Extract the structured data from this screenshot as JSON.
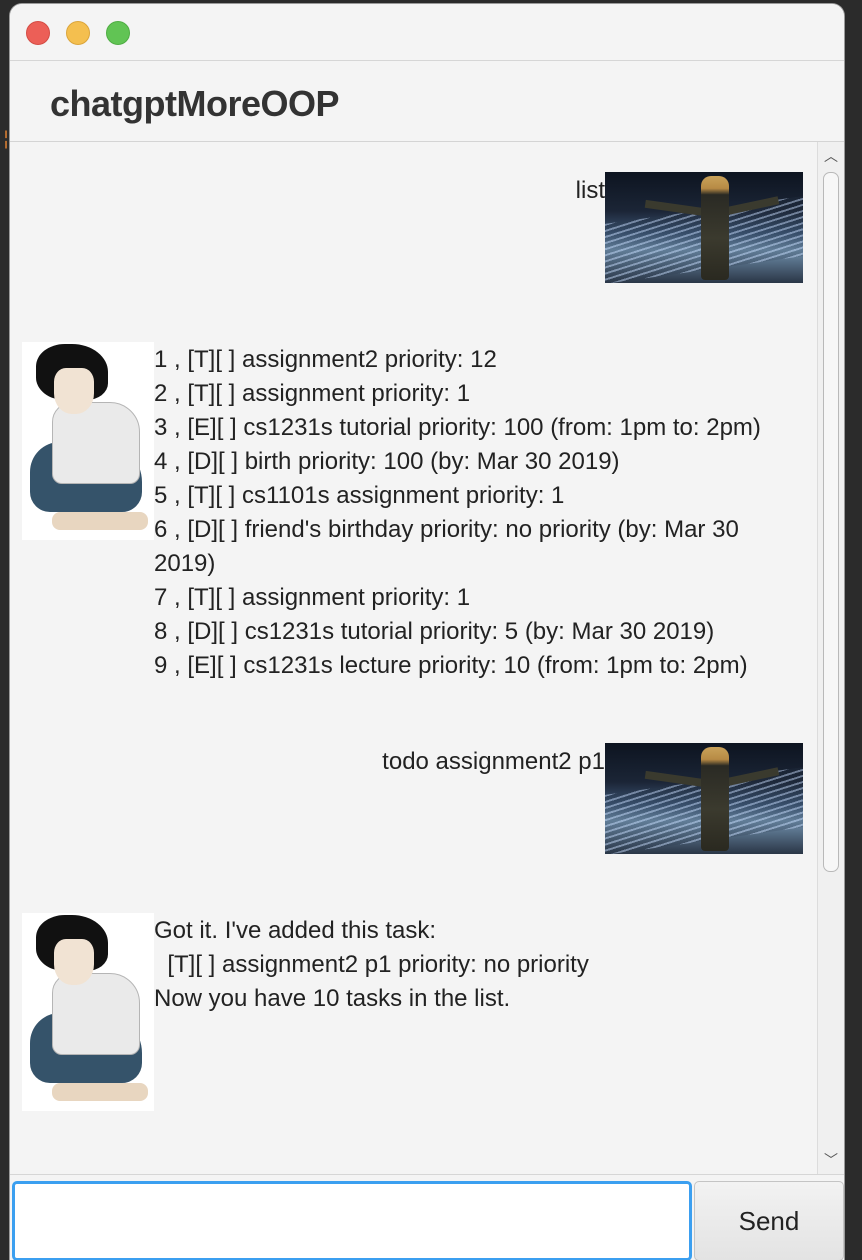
{
  "app": {
    "title": "chatgptMoreOOP"
  },
  "window_controls": {
    "close_icon": "close-icon",
    "minimize_icon": "minimize-icon",
    "maximize_icon": "maximize-icon",
    "colors": {
      "close": "#ec5f57",
      "minimize": "#f4bf4f",
      "maximize": "#61c454"
    }
  },
  "dialogs": [
    {
      "speaker": "user",
      "text": "list"
    },
    {
      "speaker": "bot",
      "text": "1 , [T][ ] assignment2 priority: 12\n2 , [T][ ] assignment priority: 1\n3 , [E][ ] cs1231s tutorial priority: 100 (from: 1pm to: 2pm)\n4 , [D][ ] birth priority: 100 (by: Mar 30 2019)\n5 , [T][ ] cs1101s assignment priority: 1\n6 , [D][ ] friend's birthday priority: no priority (by: Mar 30\n2019)\n7 , [T][ ] assignment priority: 1\n8 , [D][ ] cs1231s tutorial priority: 5 (by: Mar 30 2019)\n9 , [E][ ] cs1231s lecture priority: 10 (from: 1pm to: 2pm)"
    },
    {
      "speaker": "user",
      "text": "todo assignment2 p1"
    },
    {
      "speaker": "bot",
      "text": "Got it. I've added this task:\n  [T][ ] assignment2 p1 priority: no priority\nNow you have 10 tasks in the list."
    }
  ],
  "input": {
    "value": "",
    "placeholder": "",
    "accent_color": "#3b9ff0"
  },
  "send_button": {
    "label": "Send"
  },
  "scrollbar": {
    "up_icon": "chevron-up-icon",
    "down_icon": "chevron-down-icon",
    "up_glyph": "︿",
    "down_glyph": "﹀"
  }
}
